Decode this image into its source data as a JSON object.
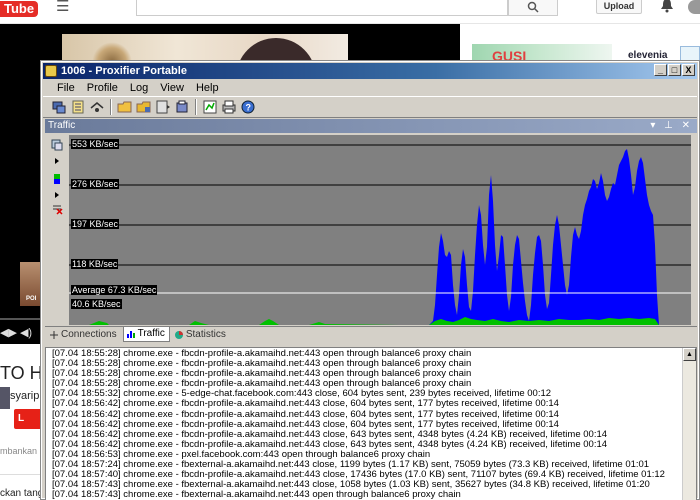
{
  "browser": {
    "logo_text": "Tube",
    "upload_label": "Upload",
    "video_title": "TO HA",
    "channel_name": "syarip",
    "subscribe_label": "L",
    "share_text": "mbankan k",
    "desc_text": "ckan tang",
    "left_thumb_text": "POI",
    "ad_brand": "elevenia",
    "ad_text": "GUSI"
  },
  "window": {
    "title": "1006 - Proxifier Portable",
    "controls": {
      "minimize": "_",
      "maximize": "□",
      "close": "X"
    }
  },
  "menu": [
    "File",
    "Profile",
    "Log",
    "View",
    "Help"
  ],
  "toolbar": {
    "icons": [
      "proxy-servers-icon",
      "rules-icon",
      "resolve-icon",
      "open-profile-icon",
      "save-profile-icon",
      "options-icon",
      "export-icon",
      "advanced-icon",
      "print-icon",
      "help-icon"
    ]
  },
  "traffic_pane": {
    "title": "Traffic",
    "controls": "▾ ⊥ ✕",
    "labels": {
      "l1": "553 KB/sec",
      "l2": "276 KB/sec",
      "l3": "197 KB/sec",
      "l4": "118 KB/sec",
      "avg": "Average 67.3 KB/sec",
      "l5": "40.6 KB/sec"
    }
  },
  "tabs": [
    {
      "label": "Connections",
      "active": false
    },
    {
      "label": "Traffic",
      "active": true
    },
    {
      "label": "Statistics",
      "active": false
    }
  ],
  "log": [
    "[07.04 18:55:28] chrome.exe - fbcdn-profile-a.akamaihd.net:443 open through balance6 proxy chain",
    "[07.04 18:55:28] chrome.exe - fbcdn-profile-a.akamaihd.net:443 open through balance6 proxy chain",
    "[07.04 18:55:28] chrome.exe - fbcdn-profile-a.akamaihd.net:443 open through balance6 proxy chain",
    "[07.04 18:55:28] chrome.exe - fbcdn-profile-a.akamaihd.net:443 open through balance6 proxy chain",
    "[07.04 18:55:32] chrome.exe - 5-edge-chat.facebook.com:443 close, 604 bytes sent, 239 bytes received, lifetime 00:12",
    "[07.04 18:56:42] chrome.exe - fbcdn-profile-a.akamaihd.net:443 close, 604 bytes sent, 177 bytes received, lifetime 00:14",
    "[07.04 18:56:42] chrome.exe - fbcdn-profile-a.akamaihd.net:443 close, 604 bytes sent, 177 bytes received, lifetime 00:14",
    "[07.04 18:56:42] chrome.exe - fbcdn-profile-a.akamaihd.net:443 close, 604 bytes sent, 177 bytes received, lifetime 00:14",
    "[07.04 18:56:42] chrome.exe - fbcdn-profile-a.akamaihd.net:443 close, 643 bytes sent, 4348 bytes (4.24 KB) received, lifetime 00:14",
    "[07.04 18:56:42] chrome.exe - fbcdn-profile-a.akamaihd.net:443 close, 643 bytes sent, 4348 bytes (4.24 KB) received, lifetime 00:14",
    "[07.04 18:56:53] chrome.exe - pxel.facebook.com:443 open through balance6 proxy chain",
    "[07.04 18:57:24] chrome.exe - fbexternal-a.akamaihd.net:443 close, 1199 bytes (1.17 KB) sent, 75059 bytes (73.3 KB) received, lifetime 01:01",
    "[07.04 18:57:40] chrome.exe - fbcdn-profile-a.akamaihd.net:443 close, 17436 bytes (17.0 KB) sent, 71107 bytes (69.4 KB) received, lifetime 01:12",
    "[07.04 18:57:43] chrome.exe - fbexternal-a.akamaihd.net:443 close, 1058 bytes (1.03 KB) sent, 35627 bytes (34.8 KB) received, lifetime 01:20",
    "[07.04 18:57:43] chrome.exe - fbexternal-a.akamaihd.net:443 open through balance6 proxy chain"
  ],
  "colors": {
    "graph_bg": "#808080",
    "traffic_received": "#0000ff",
    "traffic_sent": "#00c000",
    "title_gradient_start": "#0a246a"
  }
}
